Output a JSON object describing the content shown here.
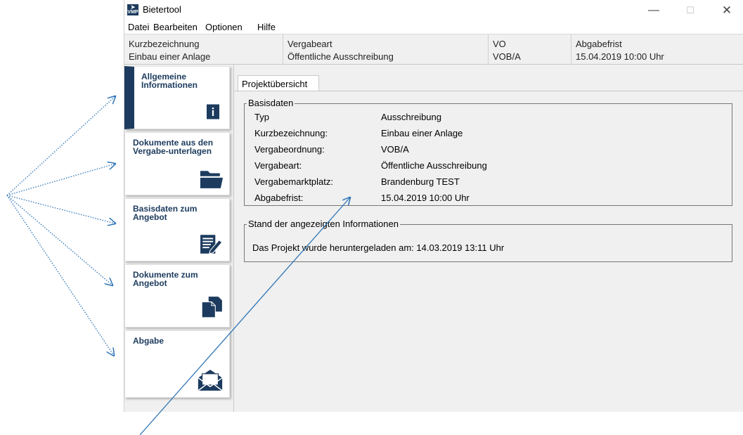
{
  "window": {
    "title": "Bietertool",
    "icon_text": "VMP",
    "controls": {
      "minimize": "—",
      "maximize": "☐",
      "close": "✕"
    }
  },
  "menu": [
    "Datei",
    "Bearbeiten",
    "Optionen",
    "Hilfe"
  ],
  "infobar": [
    {
      "label": "Kurzbezeichnung",
      "value": "Einbau einer Anlage"
    },
    {
      "label": "Vergabeart",
      "value": "Öffentliche Ausschreibung"
    },
    {
      "label": "VO",
      "value": "VOB/A"
    },
    {
      "label": "Abgabefrist",
      "value": "15.04.2019 10:00 Uhr"
    }
  ],
  "sidebar": {
    "items": [
      {
        "label": "Allgemeine Informationen",
        "icon": "info-icon",
        "active": true
      },
      {
        "label": "Dokumente aus den Vergabe-unterlagen",
        "icon": "folder-icon",
        "active": false
      },
      {
        "label": "Basisdaten zum Angebot",
        "icon": "edit-document-icon",
        "active": false
      },
      {
        "label": "Dokumente zum Angebot",
        "icon": "documents-icon",
        "active": false
      },
      {
        "label": "Abgabe",
        "icon": "envelope-icon",
        "active": false
      }
    ]
  },
  "tabs": [
    {
      "label": "Projektübersicht",
      "active": true
    }
  ],
  "basisdaten": {
    "title": "Basisdaten",
    "rows": [
      {
        "label": "Typ",
        "value": "Ausschreibung"
      },
      {
        "label": "Kurzbezeichnung:",
        "value": "Einbau einer Anlage"
      },
      {
        "label": "Vergabeordnung:",
        "value": "VOB/A"
      },
      {
        "label": "Vergabeart:",
        "value": "Öffentliche Ausschreibung"
      },
      {
        "label": "Vergabemarktplatz:",
        "value": "Brandenburg TEST"
      },
      {
        "label": "Abgabefrist:",
        "value": "15.04.2019 10:00 Uhr"
      }
    ]
  },
  "stand": {
    "title": "Stand der angezeigten Informationen",
    "text": "Das Projekt wurde heruntergeladen am: 14.03.2019 13:11 Uhr"
  },
  "colors": {
    "accent": "#1c3b5e",
    "annotation_arrow": "#2e75b6",
    "background": "#f0f0f0"
  }
}
